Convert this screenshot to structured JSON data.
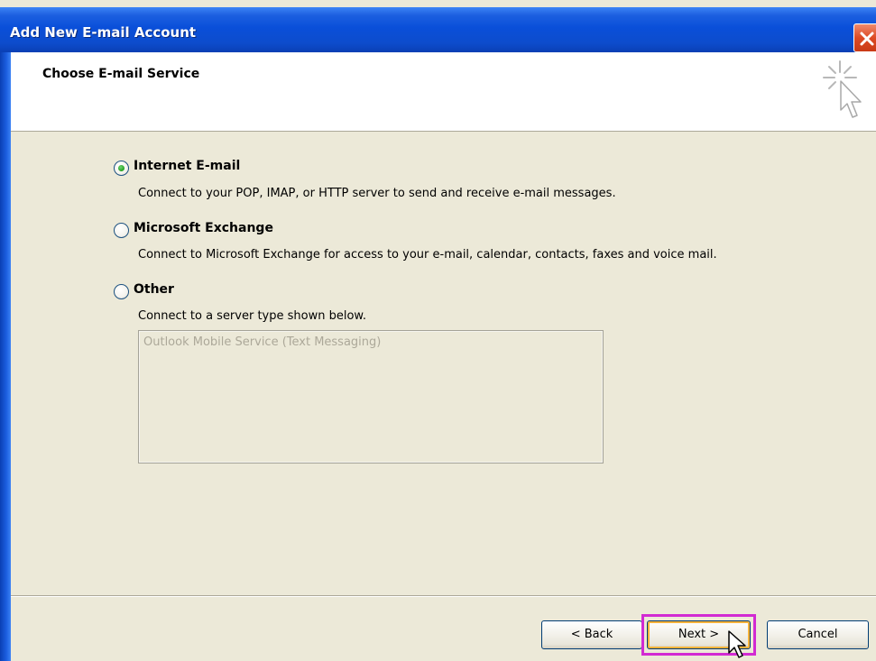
{
  "window": {
    "title": "Add New E-mail Account",
    "close_icon": "close-icon"
  },
  "header": {
    "title": "Choose E-mail Service",
    "icon": "wizard-cursor-icon"
  },
  "options": [
    {
      "label": "Internet E-mail",
      "description": "Connect to your POP, IMAP, or HTTP server to send and receive e-mail messages.",
      "selected": true
    },
    {
      "label": "Microsoft Exchange",
      "description": "Connect to Microsoft Exchange for access to your e-mail, calendar, contacts, faxes and voice mail.",
      "selected": false
    },
    {
      "label": "Other",
      "description": "Connect to a server type shown below.",
      "selected": false
    }
  ],
  "server_list": {
    "items": [
      "Outlook Mobile Service (Text Messaging)"
    ],
    "enabled": false
  },
  "buttons": {
    "back": "< Back",
    "next": "Next >",
    "cancel": "Cancel"
  },
  "colors": {
    "titlebar": "#0a4fd9",
    "dialog_bg": "#ece9d8",
    "highlight": "#d22ad2",
    "close_button": "#dd4a24"
  }
}
